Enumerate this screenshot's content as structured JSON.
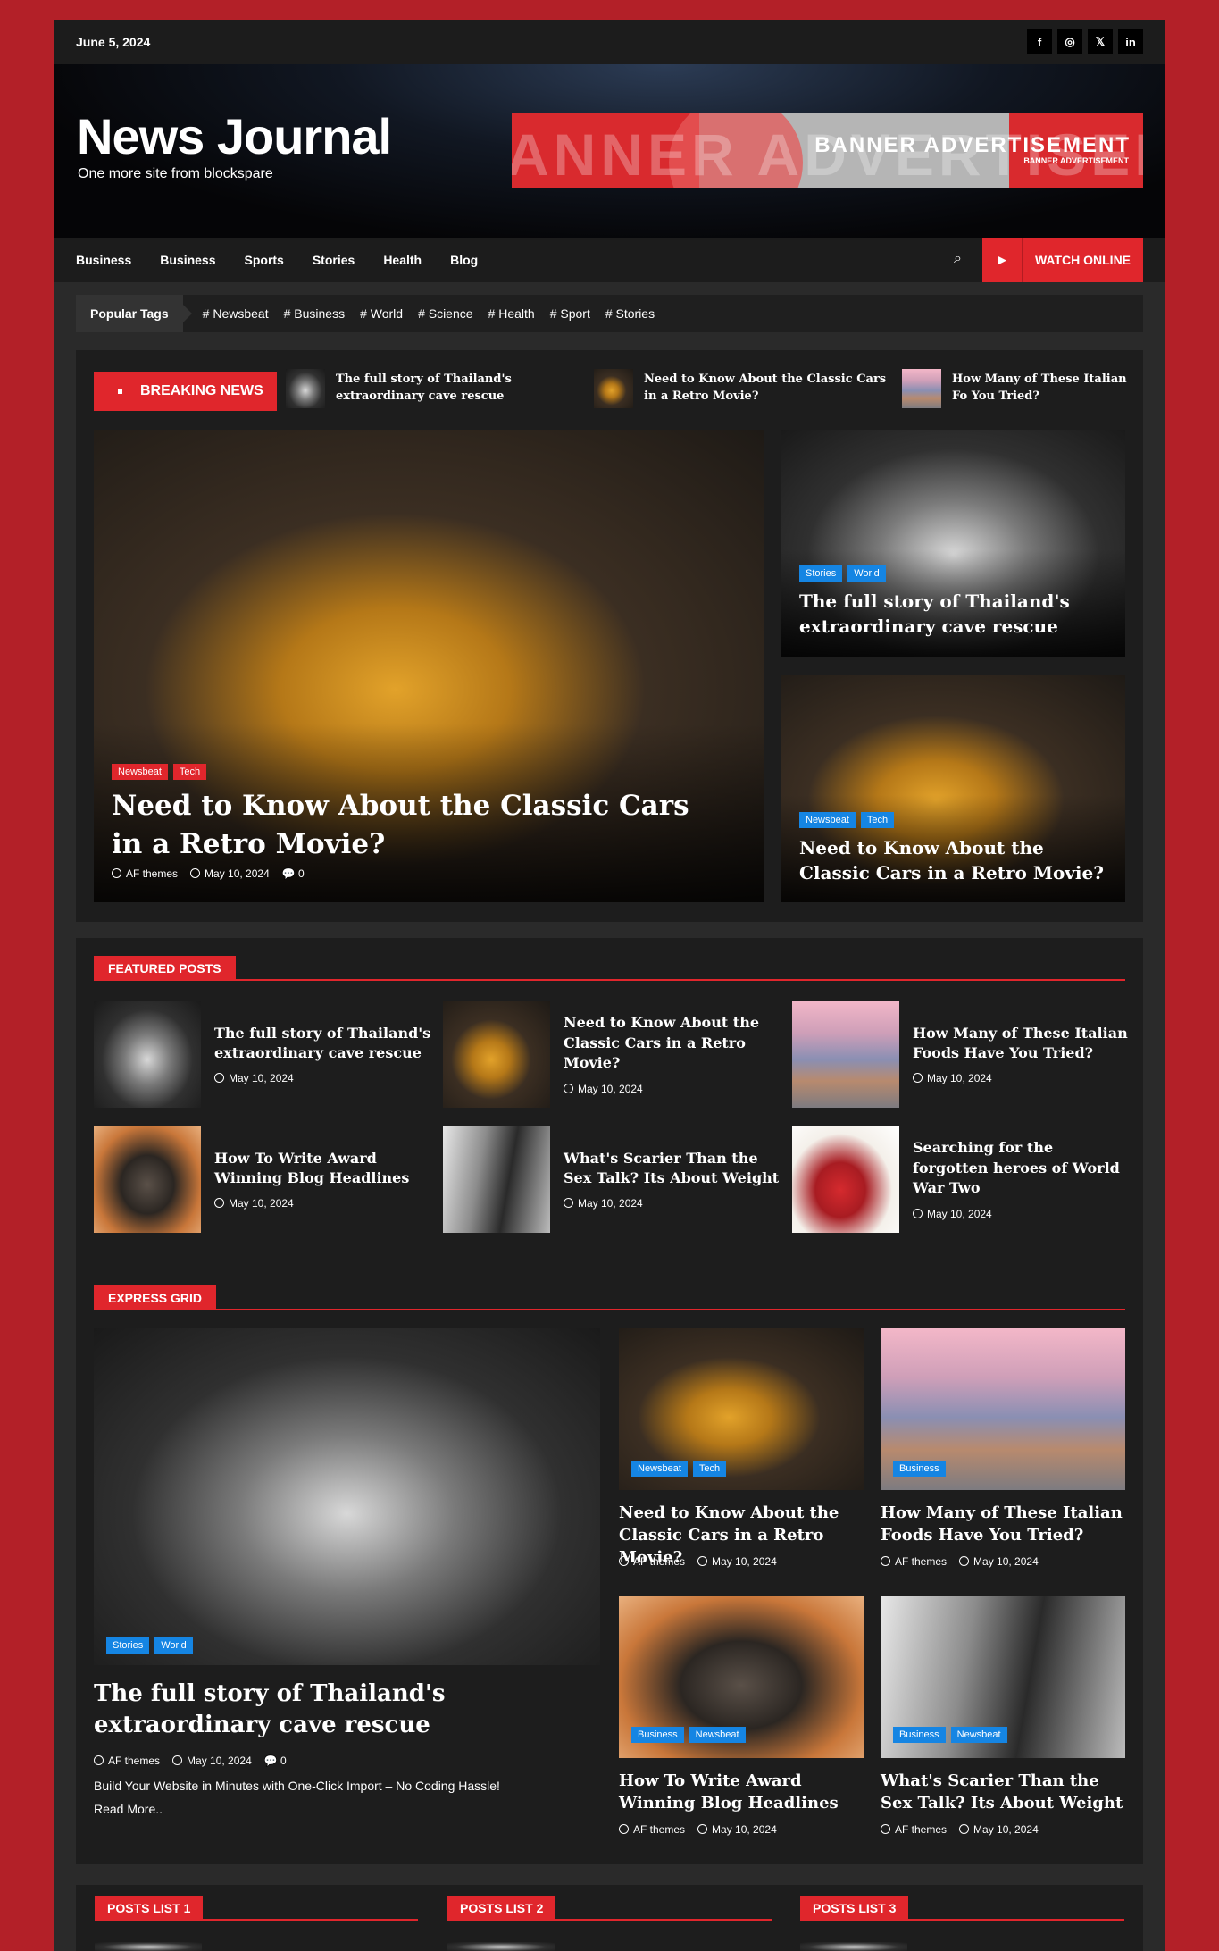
{
  "topbar": {
    "date": "June 5, 2024",
    "social": [
      "f",
      "◎",
      "𝕏",
      "in"
    ]
  },
  "header": {
    "site_title": "News Journal",
    "tagline": "One more site from blockspare",
    "banner": {
      "bg_text": "ANNER ADVERTISEMEN",
      "title": "BANNER ADVERTISEMENT",
      "subtitle": "BANNER ADVERTISEMENT"
    }
  },
  "nav": {
    "items": [
      "Business",
      "Business",
      "Sports",
      "Stories",
      "Health",
      "Blog"
    ],
    "search_icon": "⌕",
    "watch_label": "WATCH ONLINE",
    "play_icon": "▶"
  },
  "tags": {
    "label": "Popular Tags",
    "items": [
      "# Newsbeat",
      "# Business",
      "# World",
      "# Science",
      "# Health",
      "# Sport",
      "# Stories"
    ]
  },
  "breaking": {
    "label": "BREAKING NEWS",
    "items": [
      "The full story of Thailand's extraordinary cave rescue",
      "Need to Know About the Classic Cars in a Retro Movie?",
      "How Many of These Italian Fo You Tried?"
    ]
  },
  "hero": {
    "main": {
      "badges": [
        "Newsbeat",
        "Tech"
      ],
      "title": "Need to Know About the Classic Cars in a Retro Movie?",
      "author": "AF themes",
      "date": "May 10, 2024",
      "comments": "0"
    },
    "side1": {
      "badges": [
        "Stories",
        "World"
      ],
      "title": "The full story of Thailand's extraordinary cave rescue"
    },
    "side2": {
      "badges": [
        "Newsbeat",
        "Tech"
      ],
      "title": "Need to Know About the Classic Cars in a Retro Movie?"
    }
  },
  "featured": {
    "heading": "FEATURED POSTS",
    "posts": [
      {
        "title": "The full story of Thailand's extraordinary cave rescue",
        "date": "May 10, 2024"
      },
      {
        "title": "Need to Know About the Classic Cars in a Retro Movie?",
        "date": "May 10, 2024"
      },
      {
        "title": "How Many of These Italian Foods Have You Tried?",
        "date": "May 10, 2024"
      },
      {
        "title": "How To Write Award Winning Blog Headlines",
        "date": "May 10, 2024"
      },
      {
        "title": "What's Scarier Than the Sex Talk? Its About Weight",
        "date": "May 10, 2024"
      },
      {
        "title": "Searching for the forgotten heroes of World War Two",
        "date": "May 10, 2024"
      }
    ]
  },
  "express": {
    "heading": "EXPRESS GRID",
    "main": {
      "badges": [
        "Stories",
        "World"
      ],
      "title": "The full story of Thailand's extraordinary cave rescue",
      "author": "AF themes",
      "date": "May 10, 2024",
      "comments": "0",
      "excerpt": "Build Your Website in Minutes with One-Click Import – No Coding Hassle!",
      "read_more": "Read More.."
    },
    "cards": [
      {
        "badges": [
          "Newsbeat",
          "Tech"
        ],
        "title": "Need to Know About the Classic Cars in a Retro Movie?",
        "author": "AF themes",
        "date": "May 10, 2024"
      },
      {
        "badges": [
          "Business"
        ],
        "title": "How Many of These Italian Foods Have You Tried?",
        "author": "AF themes",
        "date": "May 10, 2024"
      },
      {
        "badges": [
          "Business",
          "Newsbeat"
        ],
        "title": "How To Write Award Winning Blog Headlines",
        "author": "AF themes",
        "date": "May 10, 2024"
      },
      {
        "badges": [
          "Business",
          "Newsbeat"
        ],
        "title": "What's Scarier Than the Sex Talk? Its About Weight",
        "author": "AF themes",
        "date": "May 10, 2024"
      }
    ]
  },
  "posts_lists": [
    "POSTS LIST 1",
    "POSTS LIST 2",
    "POSTS LIST 3"
  ],
  "colors": {
    "accent": "#e0262c",
    "badge_blue": "#1585e3",
    "page_bg": "#b32028"
  }
}
